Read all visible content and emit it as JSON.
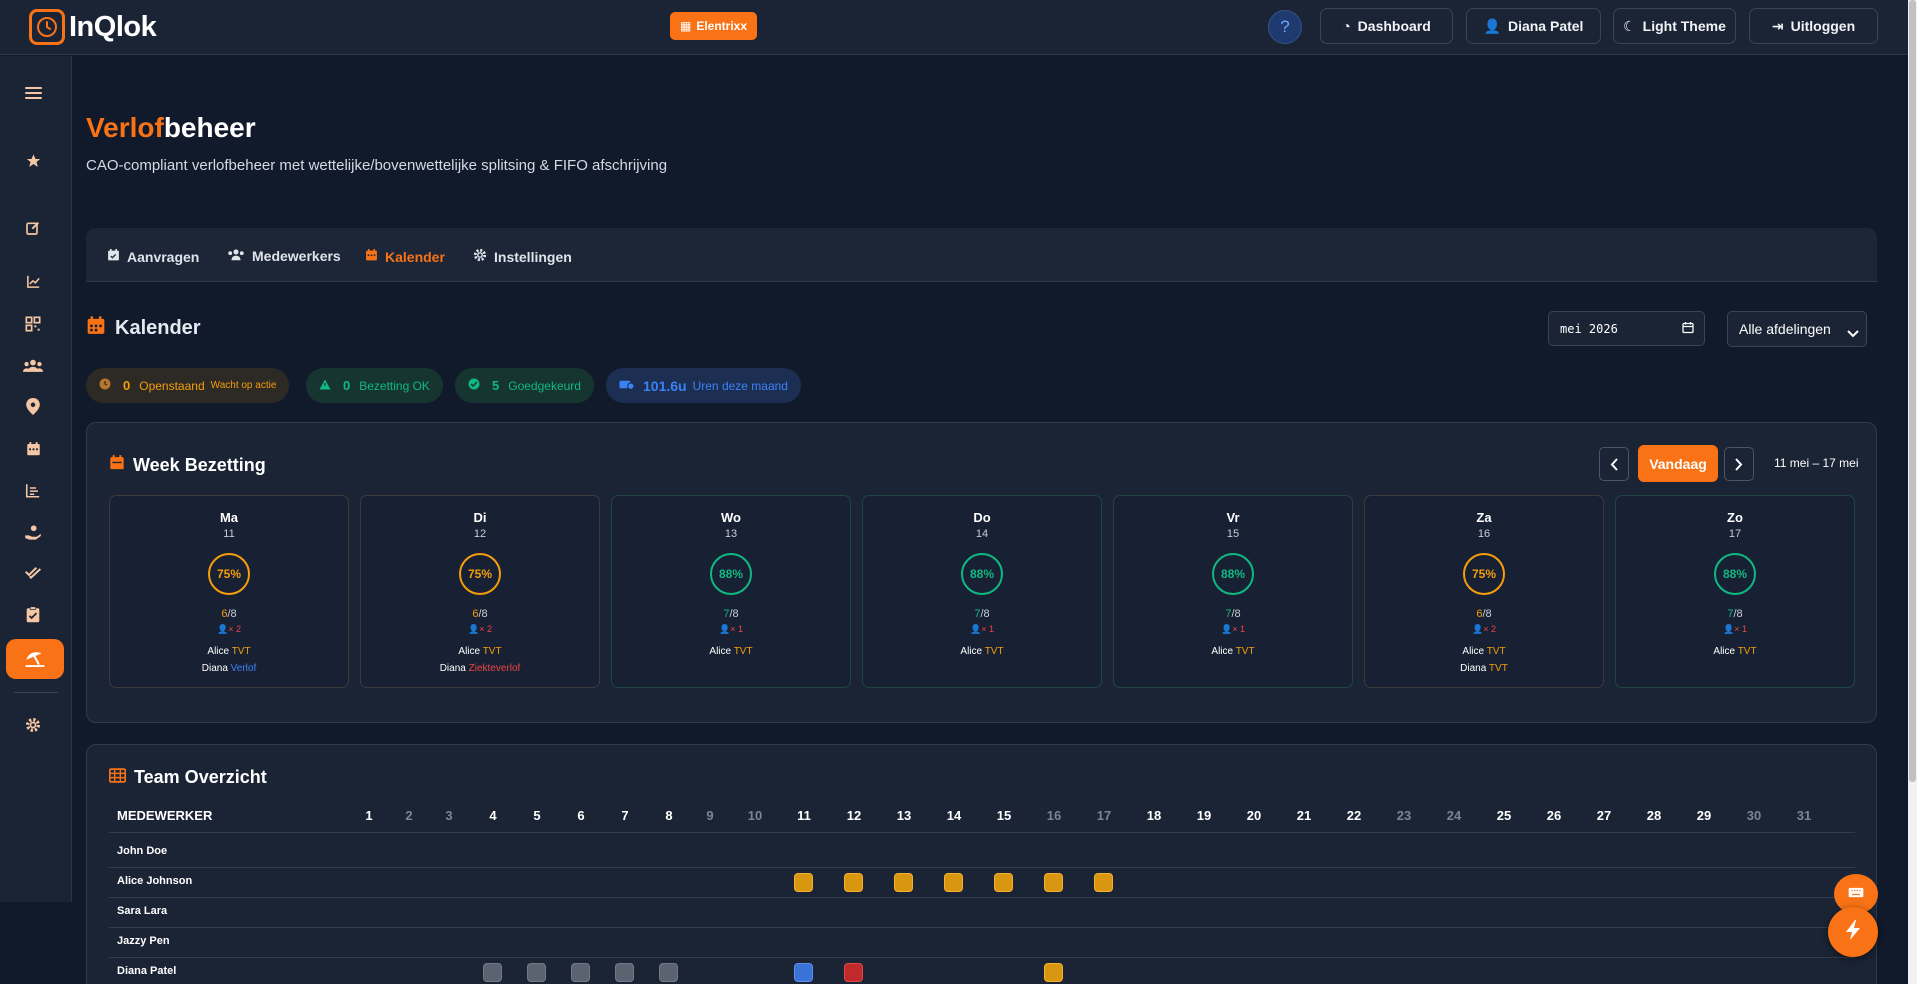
{
  "topbar": {
    "logo_text": "InQlok",
    "company": "Elentrixx",
    "help": "?",
    "dashboard": "Dashboard",
    "user": "Diana Patel",
    "theme": "Light Theme",
    "logout": "Uitloggen"
  },
  "page": {
    "title_a": "Verlof",
    "title_b": "beheer",
    "subtitle": "CAO-compliant verlofbeheer met wettelijke/bovenwettelijke splitsing & FIFO afschrijving"
  },
  "tabs": [
    {
      "label": "Aanvragen"
    },
    {
      "label": "Medewerkers"
    },
    {
      "label": "Kalender"
    },
    {
      "label": "Instellingen"
    }
  ],
  "calendar": {
    "title": "Kalender",
    "month": "mei 2026",
    "department": "Alle afdelingen"
  },
  "stats": {
    "pending_num": "0",
    "pending_label": "Openstaand",
    "pending_sub": "Wacht op actie",
    "ok_num": "0",
    "ok_label": "Bezetting OK",
    "approved_num": "5",
    "approved_label": "Goedgekeurd",
    "hours_num": "101.6u",
    "hours_label": "Uren deze maand"
  },
  "week": {
    "title": "Week Bezetting",
    "today": "Vandaag",
    "range": "11 mei – 17 mei",
    "days": [
      {
        "name": "Ma",
        "date": "11",
        "pct": "75%",
        "present": "6",
        "total": "/8",
        "absent": "2",
        "status": "warn",
        "people": [
          {
            "name": "Alice",
            "type": "TVT"
          },
          {
            "name": "Diana",
            "type": "Verlof"
          }
        ]
      },
      {
        "name": "Di",
        "date": "12",
        "pct": "75%",
        "present": "6",
        "total": "/8",
        "absent": "2",
        "status": "warn",
        "people": [
          {
            "name": "Alice",
            "type": "TVT"
          },
          {
            "name": "Diana",
            "type": "Ziekteverlof"
          }
        ]
      },
      {
        "name": "Wo",
        "date": "13",
        "pct": "88%",
        "present": "7",
        "total": "/8",
        "absent": "1",
        "status": "ok",
        "people": [
          {
            "name": "Alice",
            "type": "TVT"
          }
        ]
      },
      {
        "name": "Do",
        "date": "14",
        "pct": "88%",
        "present": "7",
        "total": "/8",
        "absent": "1",
        "status": "ok",
        "people": [
          {
            "name": "Alice",
            "type": "TVT"
          }
        ]
      },
      {
        "name": "Vr",
        "date": "15",
        "pct": "88%",
        "present": "7",
        "total": "/8",
        "absent": "1",
        "status": "ok",
        "people": [
          {
            "name": "Alice",
            "type": "TVT"
          }
        ]
      },
      {
        "name": "Za",
        "date": "16",
        "pct": "75%",
        "present": "6",
        "total": "/8",
        "absent": "2",
        "status": "warn",
        "people": [
          {
            "name": "Alice",
            "type": "TVT"
          },
          {
            "name": "Diana",
            "type": "TVT"
          }
        ]
      },
      {
        "name": "Zo",
        "date": "17",
        "pct": "88%",
        "present": "7",
        "total": "/8",
        "absent": "1",
        "status": "ok",
        "people": [
          {
            "name": "Alice",
            "type": "TVT"
          }
        ]
      }
    ]
  },
  "team": {
    "title": "Team Overzicht",
    "col_header": "MEDEWERKER",
    "days": [
      "1",
      "2",
      "3",
      "4",
      "5",
      "6",
      "7",
      "8",
      "9",
      "10",
      "11",
      "12",
      "13",
      "14",
      "15",
      "16",
      "17",
      "18",
      "19",
      "20",
      "21",
      "22",
      "23",
      "24",
      "25",
      "26",
      "27",
      "28",
      "29",
      "30",
      "31"
    ],
    "weekend_days": [
      2,
      3,
      9,
      10,
      16,
      17,
      23,
      24,
      30,
      31
    ],
    "employees": [
      {
        "name": "John Doe",
        "cells": []
      },
      {
        "name": "Alice Johnson",
        "cells": [
          {
            "day": 11,
            "type": "tvt"
          },
          {
            "day": 12,
            "type": "tvt"
          },
          {
            "day": 13,
            "type": "tvt"
          },
          {
            "day": 14,
            "type": "tvt"
          },
          {
            "day": 15,
            "type": "tvt"
          },
          {
            "day": 16,
            "type": "tvt"
          },
          {
            "day": 17,
            "type": "tvt"
          }
        ]
      },
      {
        "name": "Sara Lara",
        "cells": []
      },
      {
        "name": "Jazzy Pen",
        "cells": []
      },
      {
        "name": "Diana Patel",
        "cells": [
          {
            "day": 4,
            "type": "gray"
          },
          {
            "day": 5,
            "type": "gray"
          },
          {
            "day": 6,
            "type": "gray"
          },
          {
            "day": 7,
            "type": "gray"
          },
          {
            "day": 8,
            "type": "gray"
          },
          {
            "day": 11,
            "type": "blue"
          },
          {
            "day": 12,
            "type": "red"
          },
          {
            "day": 16,
            "type": "tvt"
          }
        ]
      }
    ]
  }
}
